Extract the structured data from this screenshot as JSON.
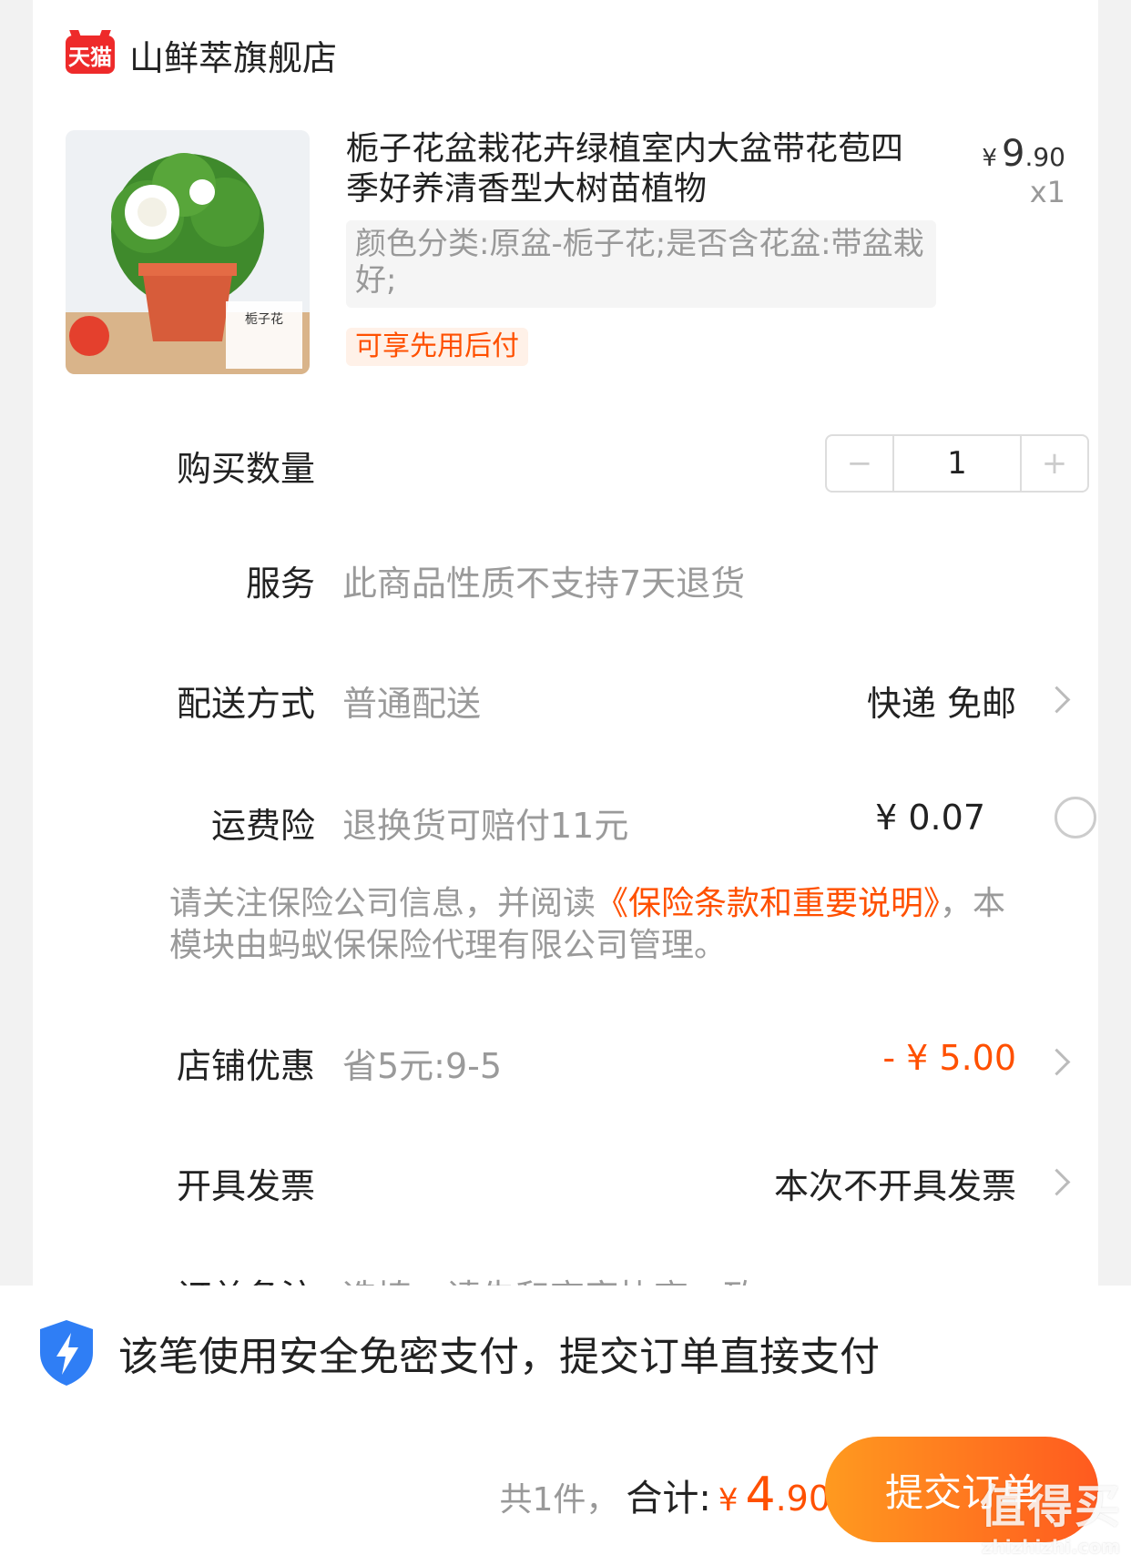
{
  "shop": {
    "logo_text": "天猫",
    "name": "山鲜萃旗舰店"
  },
  "product": {
    "title": "栀子花盆栽花卉绿植室内大盆带花苞四季好养清香型大树苗植物",
    "price_yen": "¥",
    "price_int": "9",
    "price_dec": ".90",
    "quantity_badge": "x1",
    "sku": "颜色分类:原盆-栀子花;是否含花盆:带盆栽好;",
    "pay_later_tag": "可享先用后付",
    "image_label": "栀子花"
  },
  "quantity": {
    "label": "购买数量",
    "minus": "−",
    "value": "1",
    "plus": "+"
  },
  "service": {
    "label": "服务",
    "value": "此商品性质不支持7天退货"
  },
  "delivery": {
    "label": "配送方式",
    "value": "普通配送",
    "right": "快递 免邮"
  },
  "insurance": {
    "label": "运费险",
    "value": "退换货可赔付11元",
    "price": "¥ 0.07"
  },
  "notice": {
    "before": "请关注保险公司信息，并阅读",
    "link": "《保险条款和重要说明》",
    "after": "，本模块由蚂蚁保保险代理有限公司管理。"
  },
  "discount": {
    "label": "店铺优惠",
    "value": "省5元:9-5",
    "amount": "- ¥ 5.00"
  },
  "invoice": {
    "label": "开具发票",
    "value": "本次不开具发票"
  },
  "remark": {
    "label": "订单备注",
    "placeholder": "选填，请先和商家协商一致"
  },
  "footer": {
    "secure_text": "该笔使用安全免密支付，提交订单直接支付",
    "count": "共1件，",
    "sum_label": "合计:",
    "yen": "¥",
    "total_int": "4",
    "total_dec": ".90",
    "submit": "提交订单"
  },
  "watermark": {
    "big": "值得买",
    "small": "zhizhizhi.com"
  },
  "colors": {
    "accent": "#ff5000",
    "button_start": "#ff9a1f",
    "button_end": "#ff5a1f",
    "tmall_red": "#ee2a2a"
  }
}
